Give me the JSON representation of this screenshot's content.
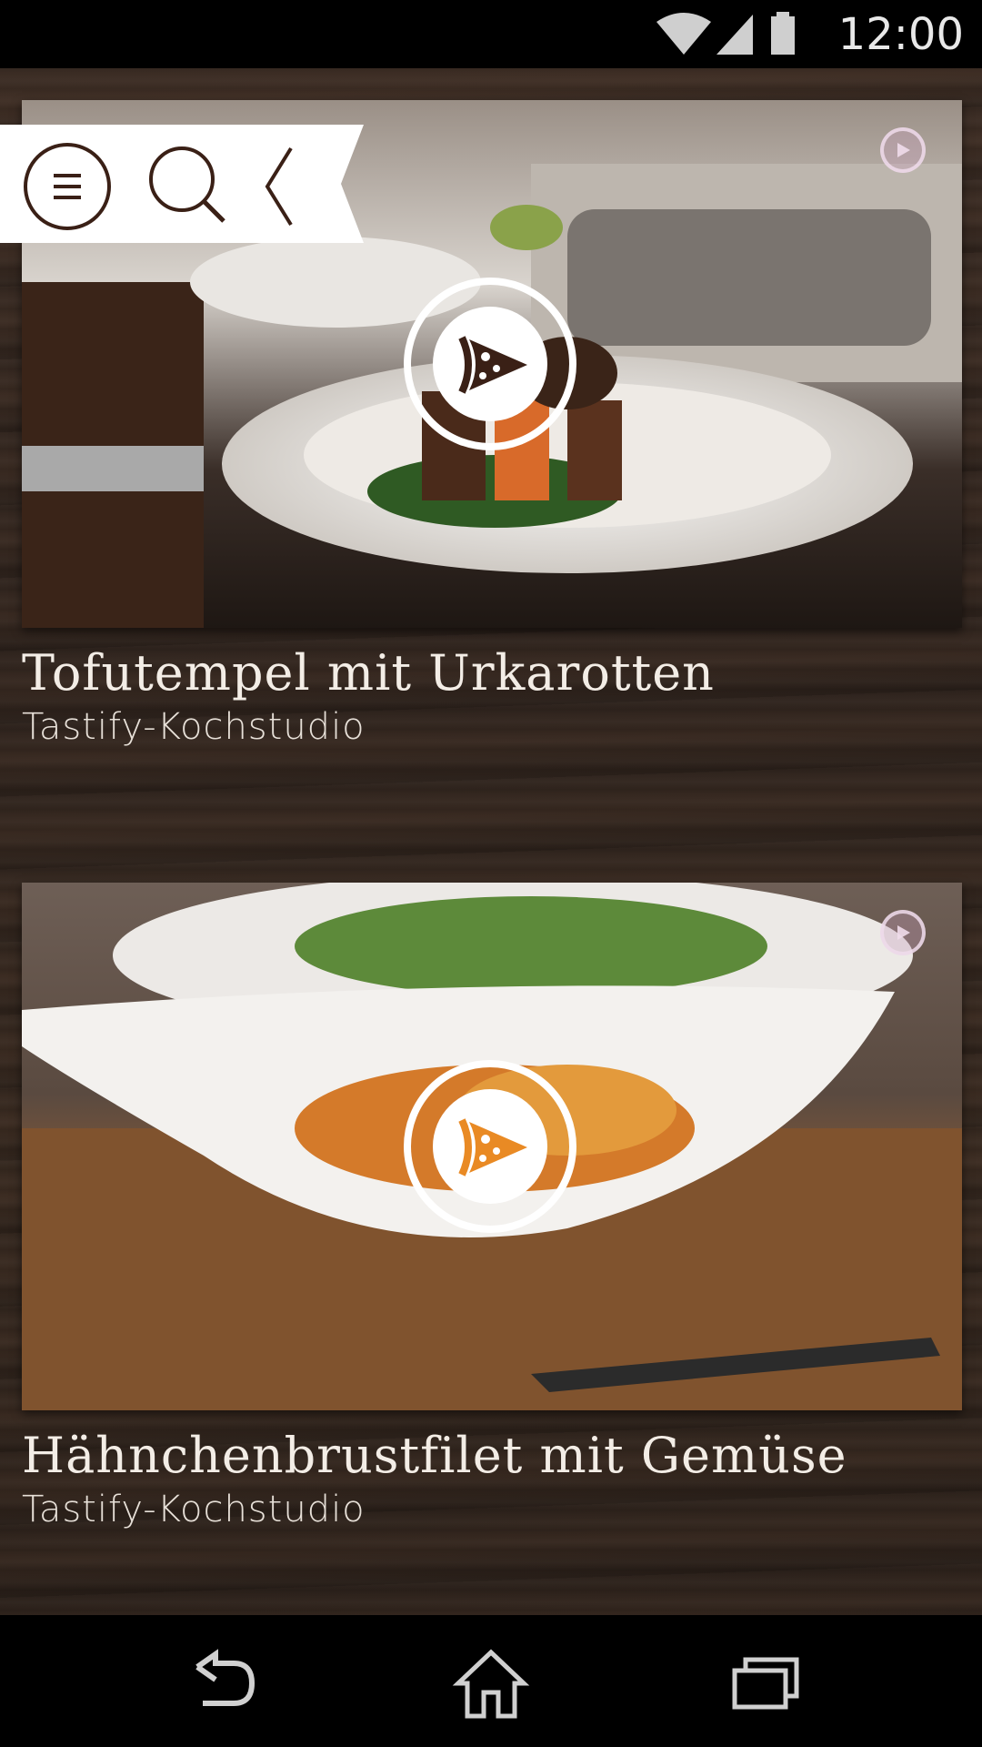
{
  "status_bar": {
    "time": "12:00",
    "icons": [
      "wifi-icon",
      "signal-icon",
      "battery-icon"
    ]
  },
  "toolbar": {
    "icons": [
      "menu-icon",
      "search-icon",
      "back-chevron-icon"
    ]
  },
  "recipes": [
    {
      "title": "Tofutempel mit Urkarotten",
      "subtitle": "Tastify-Kochstudio",
      "play_color": "#3a2016"
    },
    {
      "title": "Hähnchenbrustfilet mit Gemüse",
      "subtitle": "Tastify-Kochstudio",
      "play_color": "#e98a24"
    }
  ],
  "nav_bar": {
    "icons": [
      "nav-back-icon",
      "nav-home-icon",
      "nav-recents-icon"
    ]
  }
}
